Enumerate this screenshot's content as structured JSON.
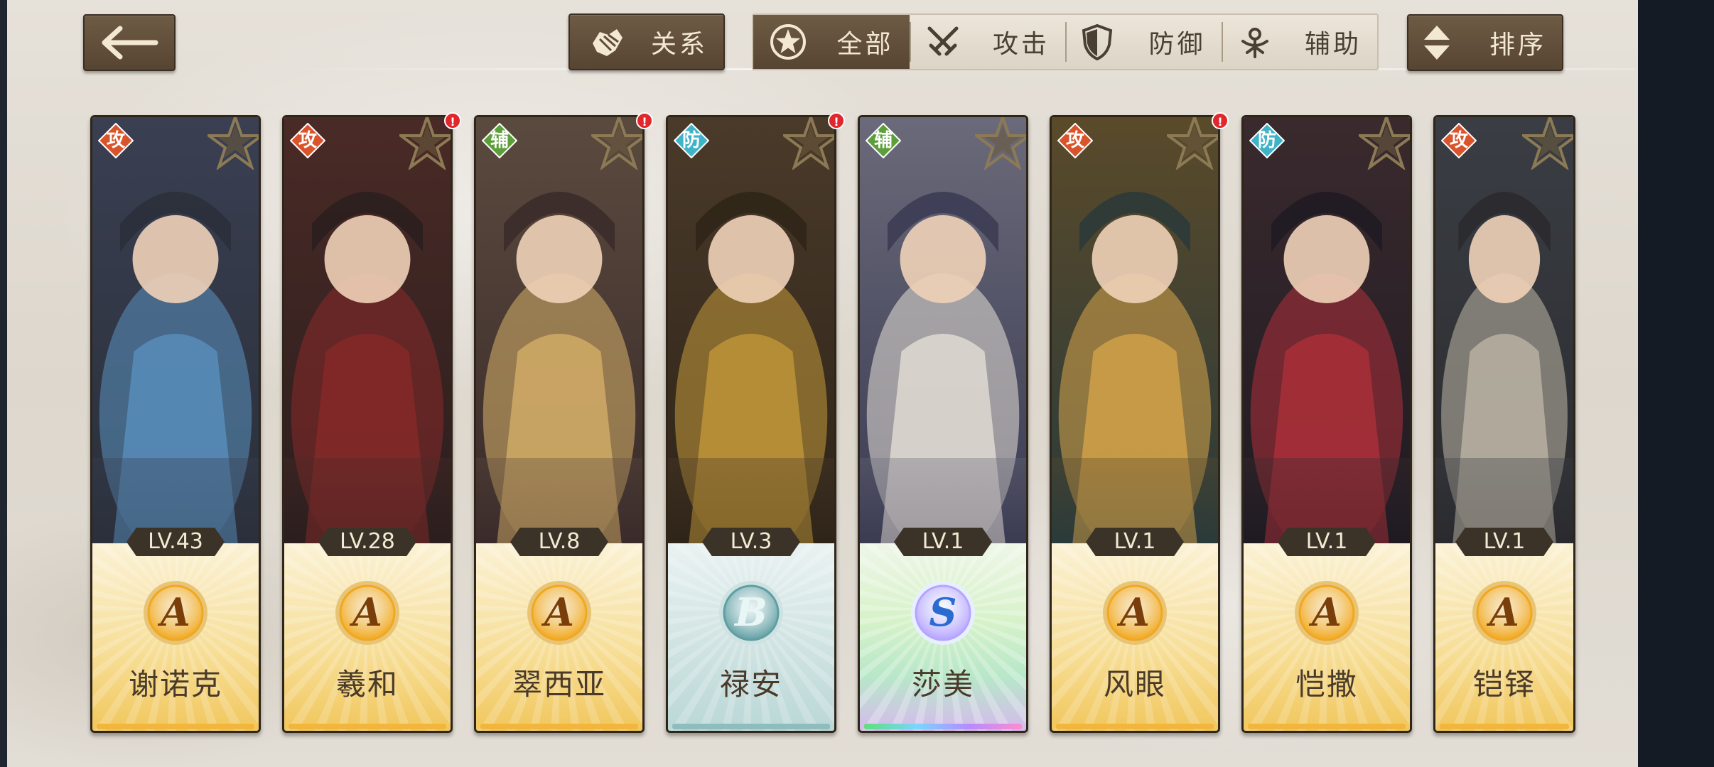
{
  "header": {
    "back_icon": "arrow-left-icon",
    "relations_label": "关系",
    "relations_icon": "handshake-icon",
    "sort_label": "排序",
    "sort_icon": "sort-arrows-icon",
    "filters": [
      {
        "label": "全部",
        "icon": "star-circle-icon",
        "active": true
      },
      {
        "label": "攻击",
        "icon": "crossed-swords-icon",
        "active": false
      },
      {
        "label": "防御",
        "icon": "shield-icon",
        "active": false
      },
      {
        "label": "辅助",
        "icon": "support-icon",
        "active": false
      }
    ]
  },
  "colors": {
    "attack_badge": "#d9542b",
    "defense_badge": "#3fb3c7",
    "support_badge": "#5c9e3a",
    "alert": "#e1262c",
    "button_brown": "#5e4b37"
  },
  "cards": [
    {
      "name": "谢诺克",
      "role": "攻",
      "level": "LV.43",
      "rank": "A",
      "alert": false
    },
    {
      "name": "羲和",
      "role": "攻",
      "level": "LV.28",
      "rank": "A",
      "alert": true
    },
    {
      "name": "翠西亚",
      "role": "辅",
      "level": "LV.8",
      "rank": "A",
      "alert": true
    },
    {
      "name": "禄安",
      "role": "防",
      "level": "LV.3",
      "rank": "B",
      "alert": true
    },
    {
      "name": "莎美",
      "role": "辅",
      "level": "LV.1",
      "rank": "S",
      "alert": false
    },
    {
      "name": "风眼",
      "role": "攻",
      "level": "LV.1",
      "rank": "A",
      "alert": true
    },
    {
      "name": "恺撒",
      "role": "防",
      "level": "LV.1",
      "rank": "A",
      "alert": false
    },
    {
      "name": "铠铎",
      "role": "攻",
      "level": "LV.1",
      "rank": "A",
      "alert": false
    }
  ]
}
